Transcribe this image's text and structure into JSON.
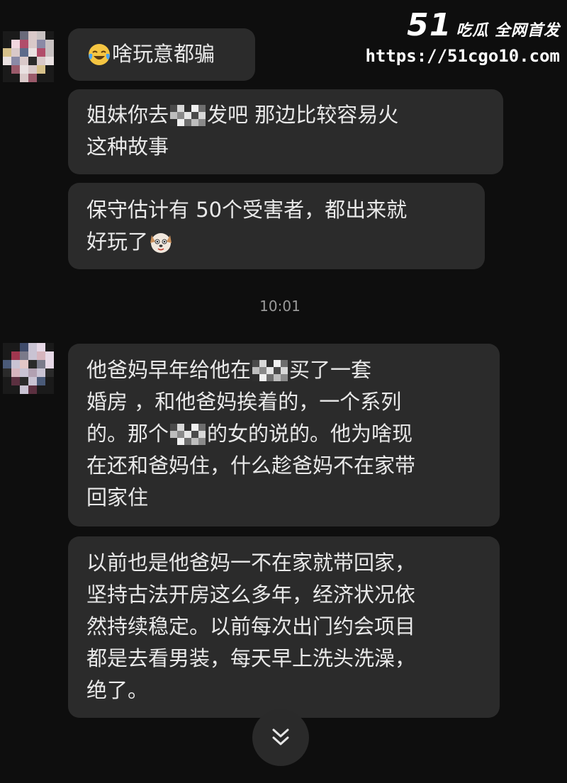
{
  "watermark": {
    "brand_num": "51",
    "brand_text": "吃瓜 全网首发",
    "url": "https://51cgo10.com"
  },
  "messages": [
    {
      "sender": "contact",
      "lines": [
        [
          "emoji:laugh-cry",
          "啥玩意都骗"
        ]
      ]
    },
    {
      "sender": "contact",
      "lines": [
        [
          "姐妹你去",
          "mosaic",
          "发吧 那边比较容易火"
        ],
        [
          "这种故事"
        ]
      ]
    },
    {
      "sender": "contact",
      "lines": [
        [
          "保守估计有 50个受害者，都出来就"
        ],
        [
          "好玩了",
          "emoji:dog-face"
        ]
      ]
    },
    {
      "sender": "contact",
      "lines": [
        [
          "他爸妈早年给他在",
          "mosaic",
          "买了一套"
        ],
        [
          "婚房 ，和他爸妈挨着的，一个系列"
        ],
        [
          "的。那个",
          "mosaic",
          "的女的说的。他为啥现"
        ],
        [
          "在还和爸妈住，什么趁爸妈不在家带"
        ],
        [
          "回家住"
        ]
      ]
    },
    {
      "sender": "contact",
      "lines": [
        [
          "以前也是他爸妈一不在家就带回家，"
        ],
        [
          "坚持古法开房这么多年，经济状况依"
        ],
        [
          "然持续稳定。以前每次出门约会项目"
        ],
        [
          "都是去看男装，每天早上洗头洗澡，"
        ],
        [
          "绝了。"
        ]
      ]
    }
  ],
  "timestamp": "10:01",
  "scroll_button_icon": "double-chevron-down-icon"
}
